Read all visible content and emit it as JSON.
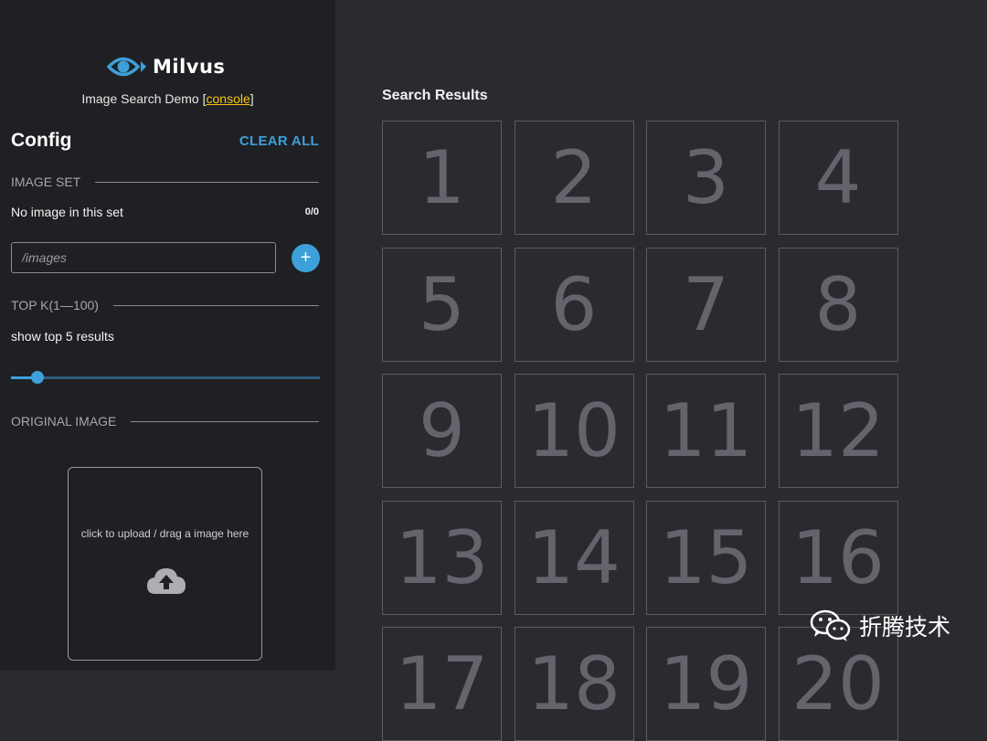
{
  "brand": {
    "name": "Milvus",
    "subtitle_prefix": "Image Search Demo [",
    "console_link": "console",
    "subtitle_suffix": "]"
  },
  "config": {
    "title": "Config",
    "clear_all": "CLEAR ALL",
    "image_set": {
      "label": "IMAGE SET",
      "status": "No image in this set",
      "count": "0/0",
      "path_placeholder": "/images"
    },
    "top_k": {
      "label": "TOP K(1—100)",
      "summary": "show top 5 results",
      "value": 5,
      "min": 1,
      "max": 100
    },
    "original_image": {
      "label": "ORIGINAL IMAGE",
      "upload_hint": "click to upload / drag a image here"
    }
  },
  "results": {
    "title": "Search Results",
    "items": [
      "1",
      "2",
      "3",
      "4",
      "5",
      "6",
      "7",
      "8",
      "9",
      "10",
      "11",
      "12",
      "13",
      "14",
      "15",
      "16",
      "17",
      "18",
      "19",
      "20"
    ]
  },
  "watermark": {
    "text": "折腾技术"
  },
  "colors": {
    "accent": "#3da0d8",
    "link": "#f0c419",
    "sidebar_bg": "#1f2023",
    "main_bg": "#2a2b2f"
  },
  "icons": {
    "logo": "eye-icon",
    "add": "plus-icon",
    "upload": "cloud-upload-icon",
    "watermark": "wechat-icon"
  }
}
